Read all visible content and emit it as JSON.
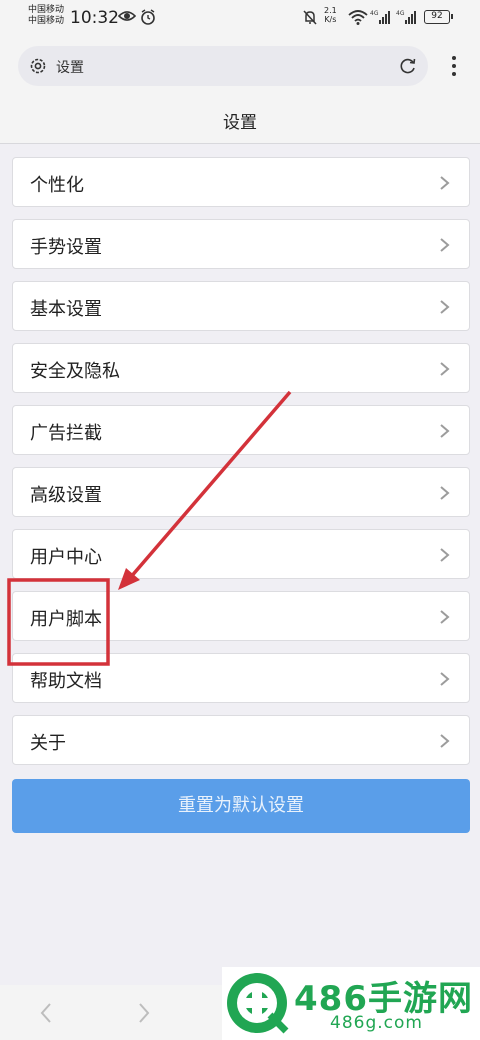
{
  "status_bar": {
    "carrier_1": "中国移动",
    "carrier_2": "中国移动",
    "time": "10:32",
    "speed_value": "2.1",
    "speed_unit": "K/s",
    "battery": "92"
  },
  "address_bar": {
    "text": "设置"
  },
  "page": {
    "title": "设置"
  },
  "settings": {
    "items": [
      {
        "label": "个性化"
      },
      {
        "label": "手势设置"
      },
      {
        "label": "基本设置"
      },
      {
        "label": "安全及隐私"
      },
      {
        "label": "广告拦截"
      },
      {
        "label": "高级设置"
      },
      {
        "label": "用户中心"
      },
      {
        "label": "用户脚本"
      },
      {
        "label": "帮助文档"
      },
      {
        "label": "关于"
      }
    ],
    "reset_label": "重置为默认设置"
  },
  "watermark": {
    "title": "486手游网",
    "domain": "486g.com"
  },
  "colors": {
    "accent_button": "#5a9ee9",
    "annotation_red": "#d3323a",
    "watermark_green": "#21a653"
  }
}
